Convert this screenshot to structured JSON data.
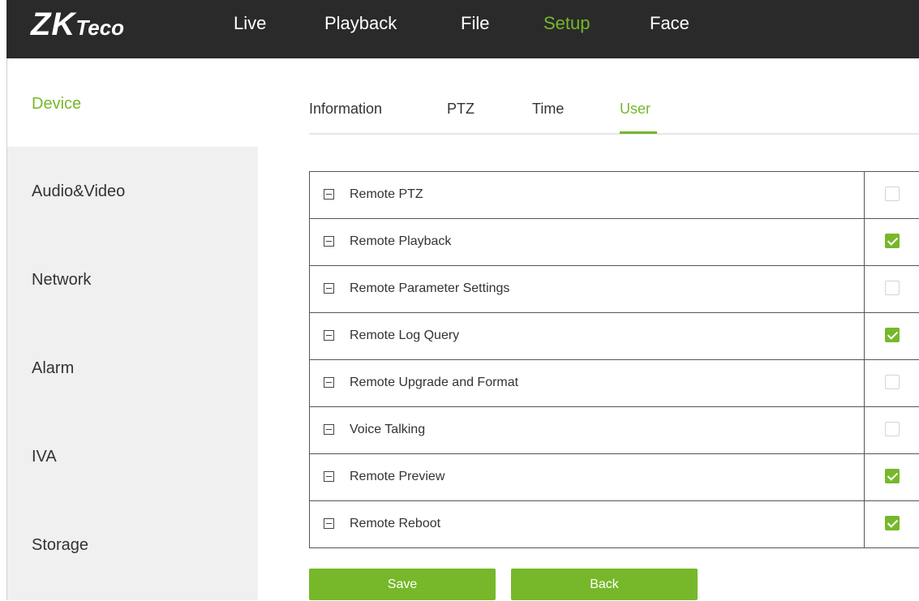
{
  "brand": {
    "logo_main": "ZK",
    "logo_sub": "Teco"
  },
  "colors": {
    "accent": "#76b82a",
    "topbar": "#2a2a2a",
    "sidebar": "#f0f0f0"
  },
  "nav": {
    "items": [
      {
        "label": "Live"
      },
      {
        "label": "Playback"
      },
      {
        "label": "File"
      },
      {
        "label": "Setup",
        "active": true
      },
      {
        "label": "Face"
      }
    ]
  },
  "sidebar": {
    "items": [
      {
        "label": "Device",
        "active": true
      },
      {
        "label": "Audio&Video"
      },
      {
        "label": "Network"
      },
      {
        "label": "Alarm"
      },
      {
        "label": "IVA"
      },
      {
        "label": "Storage"
      }
    ]
  },
  "tabs": {
    "items": [
      {
        "label": "Information"
      },
      {
        "label": "PTZ"
      },
      {
        "label": "Time"
      },
      {
        "label": "User",
        "active": true
      }
    ]
  },
  "permissions": {
    "rows": [
      {
        "label": "Remote PTZ",
        "checked": false,
        "icon": "collapse-icon"
      },
      {
        "label": "Remote Playback",
        "checked": true,
        "icon": "collapse-icon"
      },
      {
        "label": "Remote Parameter Settings",
        "checked": false,
        "icon": "collapse-icon"
      },
      {
        "label": "Remote Log Query",
        "checked": true,
        "icon": "collapse-icon"
      },
      {
        "label": "Remote Upgrade and Format",
        "checked": false,
        "icon": "collapse-icon"
      },
      {
        "label": "Voice Talking",
        "checked": false,
        "icon": "collapse-icon"
      },
      {
        "label": "Remote Preview",
        "checked": true,
        "icon": "collapse-icon"
      },
      {
        "label": "Remote Reboot",
        "checked": true,
        "icon": "collapse-icon"
      }
    ]
  },
  "actions": {
    "save_label": "Save",
    "back_label": "Back"
  }
}
